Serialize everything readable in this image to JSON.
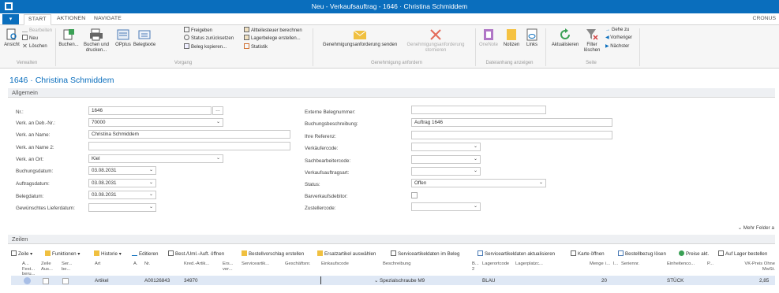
{
  "window": {
    "title": "Neu - Verkaufsauftrag - 1646 · Christina Schmiddem"
  },
  "tabs": {
    "file": "▾",
    "start": "START",
    "aktionen": "AKTIONEN",
    "navigate": "NAVIGATE",
    "company": "CRONUS"
  },
  "ribbon": {
    "verwalten": {
      "ansicht": "Ansicht",
      "bearbeiten": "Bearbeiten",
      "neu": "Neu",
      "loeschen": "Löschen",
      "group": "Verwalten"
    },
    "vorgang": {
      "buchen": "Buchen...",
      "buchen_drucken": "Buchen und drucken...",
      "opplus": "OPplus",
      "belegtexte": "Belegtexte",
      "freigeben": "Freigeben",
      "status_zurueck": "Status zurücksetzen",
      "beleg_kopieren": "Beleg kopieren...",
      "altteilesteuer": "Altteilesteuer berechnen",
      "lagerbelege": "Lagerbelege erstellen...",
      "statistik": "Statistik",
      "group": "Vorgang"
    },
    "genehmigung": {
      "senden": "Genehmigungsanforderung senden",
      "stornieren": "Genehmigungsanforderung stornieren",
      "group": "Genehmigung anfordern"
    },
    "dateianhang": {
      "onenote": "OneNote",
      "notizen": "Notizen",
      "links": "Links",
      "group": "Dateianhang anzeigen"
    },
    "seite": {
      "aktualisieren": "Aktualisieren",
      "filter_loeschen": "Filter löschen",
      "gehe_zu": "Gehe zu",
      "vorheriger": "Vorheriger",
      "naechster": "Nächster",
      "group": "Seite"
    }
  },
  "page_title": "1646 · Christina Schmiddem",
  "allgemein": {
    "header": "Allgemein",
    "nr": {
      "label": "Nr.:",
      "value": "1646"
    },
    "verk_an_deb": {
      "label": "Verk. an Deb.-Nr.:",
      "value": "70000"
    },
    "verk_an_name": {
      "label": "Verk. an Name:",
      "value": "Christina Schmiddem"
    },
    "verk_an_name2": {
      "label": "Verk. an Name 2:",
      "value": ""
    },
    "verk_an_ort": {
      "label": "Verk. an Ort:",
      "value": "Kiel"
    },
    "buchungsdatum": {
      "label": "Buchungsdatum:",
      "value": "03.08.2031"
    },
    "auftragsdatum": {
      "label": "Auftragsdatum:",
      "value": "03.08.2031"
    },
    "belegdatum": {
      "label": "Belegdatum:",
      "value": "03.08.2031"
    },
    "lieferdatum": {
      "label": "Gewünschtes Lieferdatum:",
      "value": ""
    },
    "externe_belegnr": {
      "label": "Externe Belegnummer:",
      "value": ""
    },
    "buchungsbeschreibung": {
      "label": "Buchungsbeschreibung:",
      "value": "Auftrag 1646"
    },
    "ihre_referenz": {
      "label": "Ihre Referenz:",
      "value": ""
    },
    "verkaeufercode": {
      "label": "Verkäufercode:",
      "value": ""
    },
    "sachbearbeitercode": {
      "label": "Sachbearbeitercode:",
      "value": ""
    },
    "verkaufsauftragsart": {
      "label": "Verkaufsauftragsart:",
      "value": ""
    },
    "status": {
      "label": "Status:",
      "value": "Offen"
    },
    "barverkaufsdebitor": {
      "label": "Barverkaufsdebitor:"
    },
    "zustellercode": {
      "label": "Zustellercode:",
      "value": ""
    },
    "more_fields": "Mehr Felder a"
  },
  "zeilen": {
    "header": "Zeilen",
    "toolbar": {
      "zeile": "Zeile",
      "funktionen": "Funktionen",
      "historie": "Historie",
      "editieren": "Editieren",
      "best_uml": "Best./Uml.-Auft. öffnen",
      "bestellvorschlag": "Bestellvorschlag erstellen",
      "ersatzartikel": "Ersatzartikel auswählen",
      "serviceartikeldaten": "Serviceartikeldaten im Beleg",
      "serviceartikel_akt": "Serviceartikeldaten aktualisieren",
      "karte": "Karte öffnen",
      "bestellbezug": "Bestellbezug lösen",
      "preise": "Preise akt.",
      "auf_lager": "Auf Lager bestellen"
    },
    "columns": {
      "a_beru": "A... Fest... beru...",
      "zeile_aus": "Zeile Aus...",
      "ser_be": "Ser... be...",
      "art": "Art",
      "a": "A.",
      "nr": "Nr.",
      "kred_artik": "Kred.-Artik... ",
      "ers_ver": "Ers... ver...",
      "serviceartik": "Serviceartik...",
      "geschaeftsnr": "Geschäftsnr.",
      "einkaufscode": "Einkaufscode",
      "beschreibung": "Beschreibung",
      "b2": "B... 2",
      "lagerortcode": "Lagerortcode",
      "lagerplatz": "Lagerplatzc...",
      "menge": "Menge",
      "i": "i...",
      "l": "l...",
      "seriennr": "Seriennr.",
      "einheitenco": "Einheitenco...",
      "p": "P...",
      "vk_preis": "VK-Preis Ohne MwSt."
    },
    "row": {
      "art": "Artikel",
      "nr": "A00126843",
      "kred_artik": "34970",
      "beschreibung": "Spezialschraube M9",
      "lagerortcode": "BLAU",
      "menge": "20",
      "einheit": "STÜCK",
      "vk_preis": "2,85"
    }
  }
}
